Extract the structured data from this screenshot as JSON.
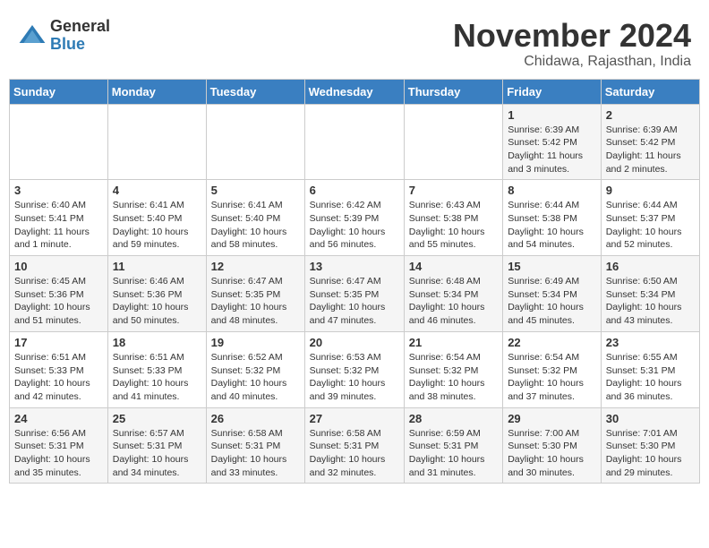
{
  "header": {
    "logo_general": "General",
    "logo_blue": "Blue",
    "month_title": "November 2024",
    "subtitle": "Chidawa, Rajasthan, India"
  },
  "weekdays": [
    "Sunday",
    "Monday",
    "Tuesday",
    "Wednesday",
    "Thursday",
    "Friday",
    "Saturday"
  ],
  "weeks": [
    [
      {
        "day": "",
        "info": ""
      },
      {
        "day": "",
        "info": ""
      },
      {
        "day": "",
        "info": ""
      },
      {
        "day": "",
        "info": ""
      },
      {
        "day": "",
        "info": ""
      },
      {
        "day": "1",
        "info": "Sunrise: 6:39 AM\nSunset: 5:42 PM\nDaylight: 11 hours\nand 3 minutes."
      },
      {
        "day": "2",
        "info": "Sunrise: 6:39 AM\nSunset: 5:42 PM\nDaylight: 11 hours\nand 2 minutes."
      }
    ],
    [
      {
        "day": "3",
        "info": "Sunrise: 6:40 AM\nSunset: 5:41 PM\nDaylight: 11 hours\nand 1 minute."
      },
      {
        "day": "4",
        "info": "Sunrise: 6:41 AM\nSunset: 5:40 PM\nDaylight: 10 hours\nand 59 minutes."
      },
      {
        "day": "5",
        "info": "Sunrise: 6:41 AM\nSunset: 5:40 PM\nDaylight: 10 hours\nand 58 minutes."
      },
      {
        "day": "6",
        "info": "Sunrise: 6:42 AM\nSunset: 5:39 PM\nDaylight: 10 hours\nand 56 minutes."
      },
      {
        "day": "7",
        "info": "Sunrise: 6:43 AM\nSunset: 5:38 PM\nDaylight: 10 hours\nand 55 minutes."
      },
      {
        "day": "8",
        "info": "Sunrise: 6:44 AM\nSunset: 5:38 PM\nDaylight: 10 hours\nand 54 minutes."
      },
      {
        "day": "9",
        "info": "Sunrise: 6:44 AM\nSunset: 5:37 PM\nDaylight: 10 hours\nand 52 minutes."
      }
    ],
    [
      {
        "day": "10",
        "info": "Sunrise: 6:45 AM\nSunset: 5:36 PM\nDaylight: 10 hours\nand 51 minutes."
      },
      {
        "day": "11",
        "info": "Sunrise: 6:46 AM\nSunset: 5:36 PM\nDaylight: 10 hours\nand 50 minutes."
      },
      {
        "day": "12",
        "info": "Sunrise: 6:47 AM\nSunset: 5:35 PM\nDaylight: 10 hours\nand 48 minutes."
      },
      {
        "day": "13",
        "info": "Sunrise: 6:47 AM\nSunset: 5:35 PM\nDaylight: 10 hours\nand 47 minutes."
      },
      {
        "day": "14",
        "info": "Sunrise: 6:48 AM\nSunset: 5:34 PM\nDaylight: 10 hours\nand 46 minutes."
      },
      {
        "day": "15",
        "info": "Sunrise: 6:49 AM\nSunset: 5:34 PM\nDaylight: 10 hours\nand 45 minutes."
      },
      {
        "day": "16",
        "info": "Sunrise: 6:50 AM\nSunset: 5:34 PM\nDaylight: 10 hours\nand 43 minutes."
      }
    ],
    [
      {
        "day": "17",
        "info": "Sunrise: 6:51 AM\nSunset: 5:33 PM\nDaylight: 10 hours\nand 42 minutes."
      },
      {
        "day": "18",
        "info": "Sunrise: 6:51 AM\nSunset: 5:33 PM\nDaylight: 10 hours\nand 41 minutes."
      },
      {
        "day": "19",
        "info": "Sunrise: 6:52 AM\nSunset: 5:32 PM\nDaylight: 10 hours\nand 40 minutes."
      },
      {
        "day": "20",
        "info": "Sunrise: 6:53 AM\nSunset: 5:32 PM\nDaylight: 10 hours\nand 39 minutes."
      },
      {
        "day": "21",
        "info": "Sunrise: 6:54 AM\nSunset: 5:32 PM\nDaylight: 10 hours\nand 38 minutes."
      },
      {
        "day": "22",
        "info": "Sunrise: 6:54 AM\nSunset: 5:32 PM\nDaylight: 10 hours\nand 37 minutes."
      },
      {
        "day": "23",
        "info": "Sunrise: 6:55 AM\nSunset: 5:31 PM\nDaylight: 10 hours\nand 36 minutes."
      }
    ],
    [
      {
        "day": "24",
        "info": "Sunrise: 6:56 AM\nSunset: 5:31 PM\nDaylight: 10 hours\nand 35 minutes."
      },
      {
        "day": "25",
        "info": "Sunrise: 6:57 AM\nSunset: 5:31 PM\nDaylight: 10 hours\nand 34 minutes."
      },
      {
        "day": "26",
        "info": "Sunrise: 6:58 AM\nSunset: 5:31 PM\nDaylight: 10 hours\nand 33 minutes."
      },
      {
        "day": "27",
        "info": "Sunrise: 6:58 AM\nSunset: 5:31 PM\nDaylight: 10 hours\nand 32 minutes."
      },
      {
        "day": "28",
        "info": "Sunrise: 6:59 AM\nSunset: 5:31 PM\nDaylight: 10 hours\nand 31 minutes."
      },
      {
        "day": "29",
        "info": "Sunrise: 7:00 AM\nSunset: 5:30 PM\nDaylight: 10 hours\nand 30 minutes."
      },
      {
        "day": "30",
        "info": "Sunrise: 7:01 AM\nSunset: 5:30 PM\nDaylight: 10 hours\nand 29 minutes."
      }
    ]
  ]
}
